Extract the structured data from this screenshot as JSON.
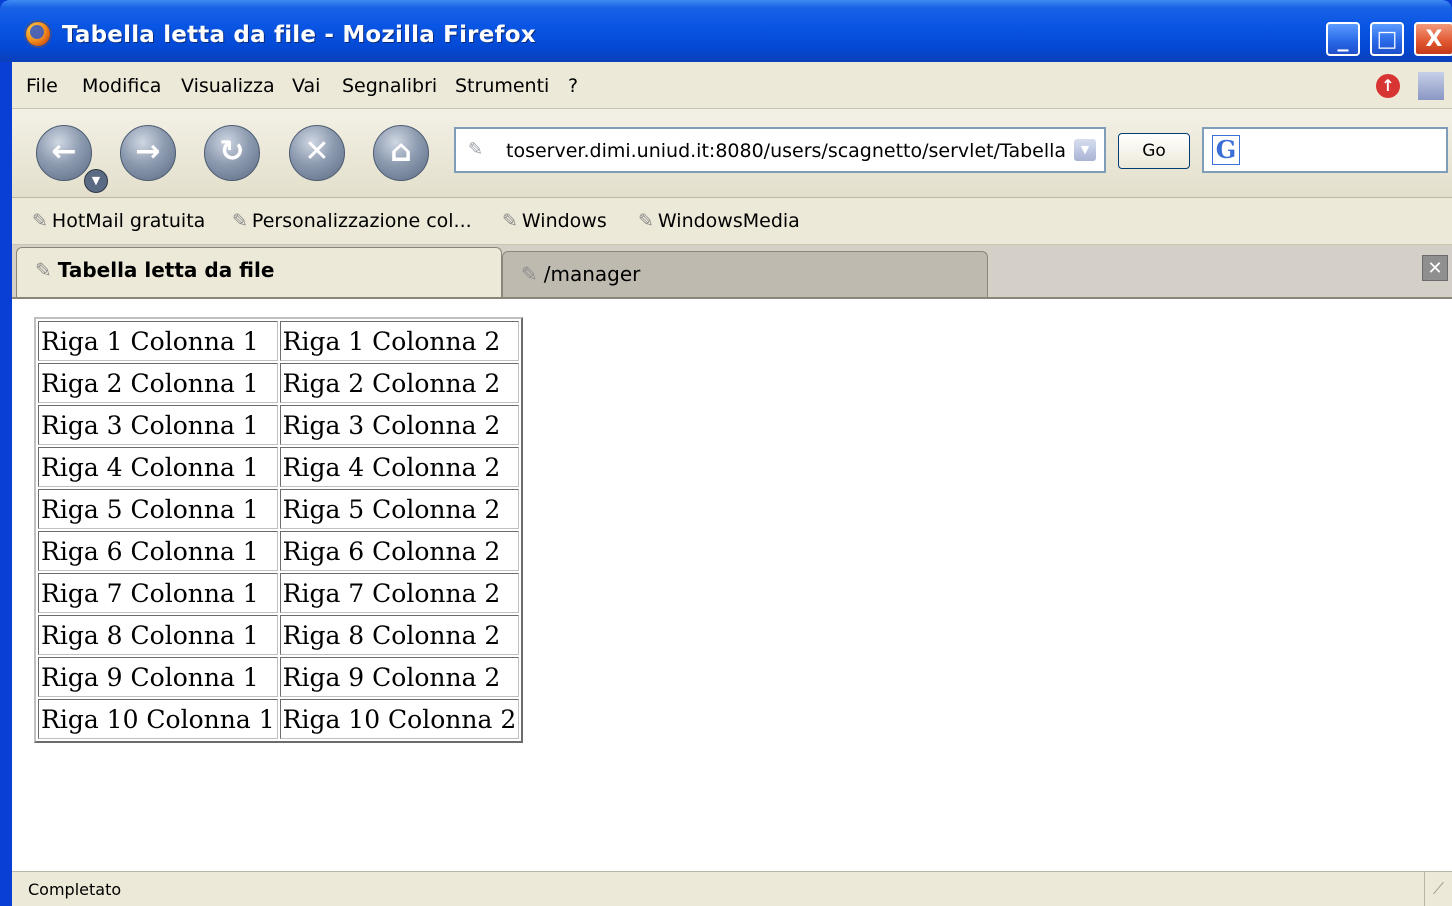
{
  "window": {
    "title": "Tabella letta da file - Mozilla Firefox",
    "min_label": "_",
    "max_label": "□",
    "close_label": "X"
  },
  "menu": {
    "items": [
      "File",
      "Modifica",
      "Visualizza",
      "Vai",
      "Segnalibri",
      "Strumenti",
      "?"
    ]
  },
  "nav": {
    "url": "toserver.dimi.uniud.it:8080/users/scagnetto/servlet/Tabella",
    "go_label": "Go",
    "search_value": ""
  },
  "bookmarks": [
    "HotMail gratuita",
    "Personalizzazione col...",
    "Windows",
    "WindowsMedia"
  ],
  "tabs": [
    {
      "label": "Tabella letta da file",
      "active": true
    },
    {
      "label": "/manager",
      "active": false
    }
  ],
  "table": {
    "rows": [
      [
        "Riga 1 Colonna 1",
        "Riga 1 Colonna 2"
      ],
      [
        "Riga 2 Colonna 1",
        "Riga 2 Colonna 2"
      ],
      [
        "Riga 3 Colonna 1",
        "Riga 3 Colonna 2"
      ],
      [
        "Riga 4 Colonna 1",
        "Riga 4 Colonna 2"
      ],
      [
        "Riga 5 Colonna 1",
        "Riga 5 Colonna 2"
      ],
      [
        "Riga 6 Colonna 1",
        "Riga 6 Colonna 2"
      ],
      [
        "Riga 7 Colonna 1",
        "Riga 7 Colonna 2"
      ],
      [
        "Riga 8 Colonna 1",
        "Riga 8 Colonna 2"
      ],
      [
        "Riga 9 Colonna 1",
        "Riga 9 Colonna 2"
      ],
      [
        "Riga 10 Colonna 1",
        "Riga 10 Colonna 2"
      ]
    ]
  },
  "status": {
    "text": "Completato"
  },
  "colors": {
    "titlebar": "#0a56e4",
    "chrome": "#ece9d8",
    "content": "#ffffff"
  }
}
